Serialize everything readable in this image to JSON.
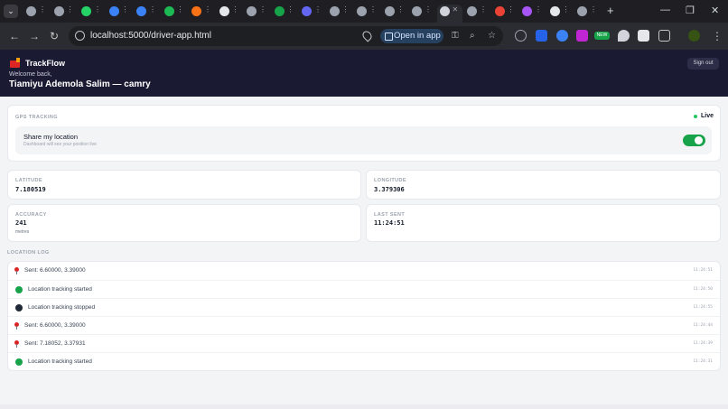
{
  "browser": {
    "url": "localhost:5000/driver-app.html",
    "open_in_app_label": "Open in app",
    "tab_count": 21,
    "new_badge": "NEW"
  },
  "header": {
    "brand": "TrackFlow",
    "welcome": "Welcome back,",
    "driver": "Tiamiyu Ademola Salim — camry",
    "sign_out": "Sign out"
  },
  "gps": {
    "title": "GPS TRACKING",
    "status": "Live",
    "share_title": "Share my location",
    "share_subtitle": "Dashboard will see your position live",
    "sharing_on": true
  },
  "stats": {
    "latitude": {
      "label": "LATITUDE",
      "value": "7.180519"
    },
    "longitude": {
      "label": "LONGITUDE",
      "value": "3.379306"
    },
    "accuracy": {
      "label": "ACCURACY",
      "value": "241",
      "unit": "metres"
    },
    "last_sent": {
      "label": "LAST SENT",
      "value": "11:24:51"
    }
  },
  "log": {
    "title": "LOCATION LOG",
    "entries": [
      {
        "icon": "pin",
        "text": "Sent: 6.60000, 3.39000",
        "time": "11:24:51"
      },
      {
        "icon": "green",
        "text": "Location tracking started",
        "time": "11:24:50"
      },
      {
        "icon": "dark",
        "text": "Location tracking stopped",
        "time": "11:24:55"
      },
      {
        "icon": "pin",
        "text": "Sent: 6.60000, 3.39000",
        "time": "11:24:44"
      },
      {
        "icon": "pin",
        "text": "Sent: 7.18052, 3.37931",
        "time": "11:24:39"
      },
      {
        "icon": "green",
        "text": "Location tracking started",
        "time": "11:24:31"
      }
    ]
  },
  "colors": {
    "header_bg": "#1b1a33",
    "accent_green": "#16a34a",
    "pin_red": "#dc2626"
  }
}
